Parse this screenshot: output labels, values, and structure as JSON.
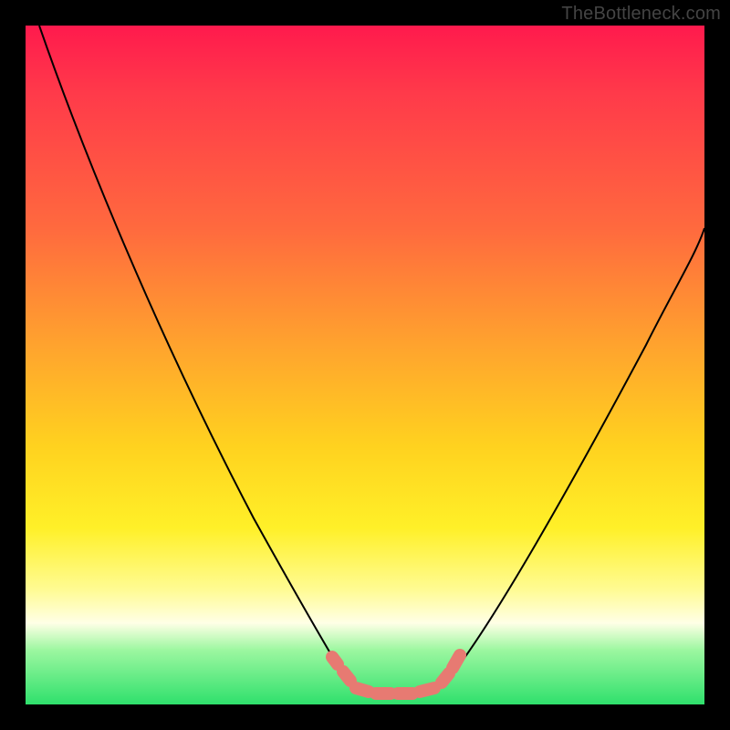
{
  "watermark": "TheBottleneck.com",
  "colors": {
    "gradient_top": "#ff1a4d",
    "gradient_mid1": "#ff6a3e",
    "gradient_mid2": "#ffd21f",
    "gradient_mid3": "#fffb92",
    "gradient_bottom": "#2fe06c",
    "curve": "#000000",
    "dots": "#e77a72",
    "frame": "#000000"
  },
  "chart_data": {
    "type": "line",
    "title": "",
    "xlabel": "",
    "ylabel": "",
    "xlim": [
      0,
      100
    ],
    "ylim": [
      0,
      100
    ],
    "annotations": [
      "TheBottleneck.com"
    ],
    "series": [
      {
        "name": "left-branch",
        "x": [
          2,
          10,
          20,
          30,
          40,
          45,
          48
        ],
        "y": [
          100,
          82,
          60,
          38,
          14,
          4,
          0
        ]
      },
      {
        "name": "valley",
        "x": [
          48,
          52,
          56,
          60,
          62
        ],
        "y": [
          0,
          0,
          0,
          0,
          0
        ]
      },
      {
        "name": "right-branch",
        "x": [
          62,
          70,
          80,
          90,
          100
        ],
        "y": [
          0,
          12,
          30,
          50,
          70
        ]
      }
    ],
    "highlight_points": {
      "name": "bottom-dots",
      "x": [
        47,
        49,
        51,
        53,
        55,
        57,
        59,
        61,
        62,
        63
      ],
      "y": [
        3,
        1,
        0,
        0,
        0,
        0,
        0,
        1,
        3,
        5
      ]
    }
  }
}
